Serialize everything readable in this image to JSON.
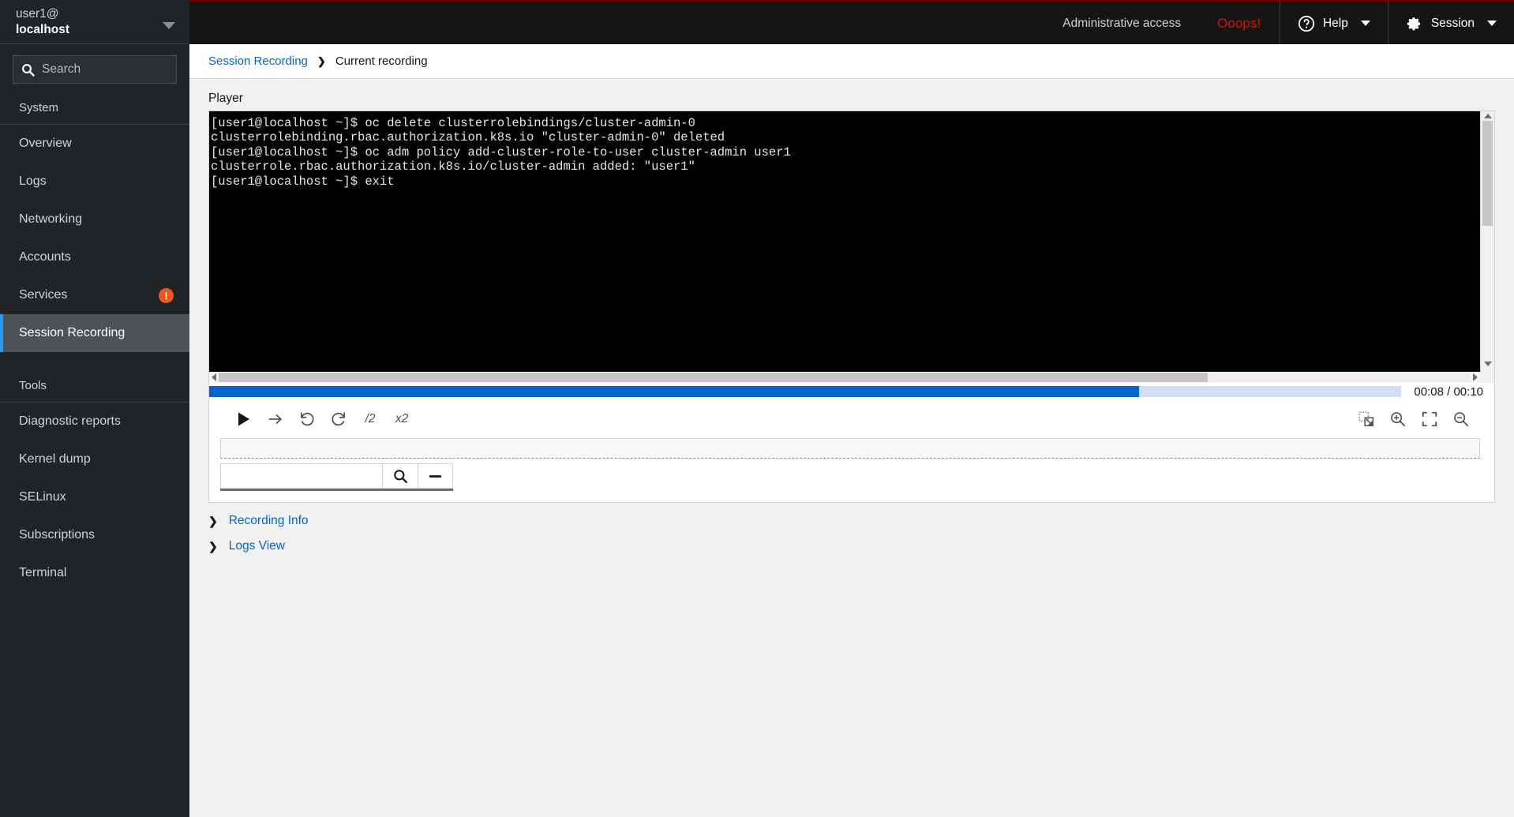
{
  "sidebar": {
    "user": {
      "top": "user1@",
      "bottom": "localhost"
    },
    "search": {
      "placeholder": "Search",
      "value": "",
      "icon": "search-icon"
    },
    "groups": [
      {
        "title": "System",
        "items": [
          {
            "label": "Overview",
            "active": false,
            "badge": ""
          },
          {
            "label": "Logs",
            "active": false,
            "badge": ""
          },
          {
            "label": "Networking",
            "active": false,
            "badge": ""
          },
          {
            "label": "Accounts",
            "active": false,
            "badge": ""
          },
          {
            "label": "Services",
            "active": false,
            "badge": "!"
          },
          {
            "label": "Session Recording",
            "active": true,
            "badge": ""
          }
        ]
      },
      {
        "title": "Tools",
        "items": [
          {
            "label": "Diagnostic reports",
            "active": false,
            "badge": ""
          },
          {
            "label": "Kernel dump",
            "active": false,
            "badge": ""
          },
          {
            "label": "SELinux",
            "active": false,
            "badge": ""
          },
          {
            "label": "Subscriptions",
            "active": false,
            "badge": ""
          },
          {
            "label": "Terminal",
            "active": false,
            "badge": ""
          }
        ]
      }
    ]
  },
  "header": {
    "admin_access": "Administrative access",
    "oops": "Ooops!",
    "help_label": "Help",
    "help_icon": "question-circle-icon",
    "session_label": "Session",
    "session_icon": "gear-icon"
  },
  "breadcrumb": {
    "parent": "Session Recording",
    "separator": "❯",
    "current": "Current recording"
  },
  "player": {
    "label": "Player",
    "terminal_text": "[user1@localhost ~]$ oc delete clusterrolebindings/cluster-admin-0\nclusterrolebinding.rbac.authorization.k8s.io \"cluster-admin-0\" deleted\n[user1@localhost ~]$ oc adm policy add-cluster-role-to-user cluster-admin user1\nclusterrole.rbac.authorization.k8s.io/cluster-admin added: \"user1\"\n[user1@localhost ~]$ exit",
    "progress_percent": 78,
    "time_display": "00:08 / 00:10",
    "controls": {
      "play": "play-icon",
      "skip": "skip-forward-icon",
      "rewind": "undo-icon",
      "fastforward": "redo-icon",
      "speed_down": "/2",
      "speed_up": "x2",
      "fit": "fit-to-screen-icon",
      "zoom_in": "zoom-in-icon",
      "fullscreen": "expand-icon",
      "zoom_out": "zoom-out-icon"
    },
    "wide_input": {
      "value": "",
      "placeholder": ""
    },
    "search_input": {
      "value": "",
      "placeholder": ""
    },
    "search_button_icon": "search-icon",
    "minus_button_icon": "minus-icon"
  },
  "sections": [
    {
      "label": "Recording Info",
      "chevron": "❯",
      "expanded": false
    },
    {
      "label": "Logs View",
      "chevron": "❯",
      "expanded": false
    }
  ],
  "colors": {
    "accent": "#0066cc",
    "link": "#0066cc",
    "danger": "#c9190b",
    "badge": "#f0561d",
    "sidebar_bg": "#212427",
    "header_bg": "#151515",
    "active_nav": "#2b9af3"
  }
}
